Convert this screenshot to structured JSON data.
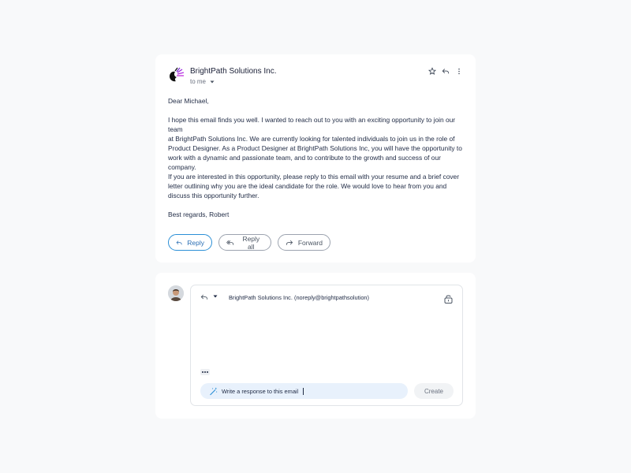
{
  "email": {
    "sender_name": "BrightPath Solutions Inc.",
    "to_label": "to me",
    "icons": [
      "star-icon",
      "reply-icon",
      "more-vertical-icon"
    ],
    "greeting": "Dear Michael,",
    "paragraph_1": [
      "I hope this email finds you well. I wanted to reach out to you with an exciting opportunity to join our team",
      "at BrightPath Solutions Inc. We are currently looking for talented individuals to join us in the role of Product Designer. As a Product Designer at BrightPath Solutions Inc, you will have the opportunity to work with a dynamic and passionate team, and to contribute to the growth and success of our company.",
      "If you are interested in this opportunity, please reply to this email with your resume and a brief cover letter outlining why you are the ideal candidate for the role. We would love to hear from you and discuss this opportunity further."
    ],
    "signoff": "Best regards, Robert",
    "actions": {
      "reply": "Reply",
      "reply_all": "Reply all",
      "forward": "Forward"
    }
  },
  "compose": {
    "recipient": "BrightPath Solutions Inc. (noreply@brightpathsolution)",
    "ai_input_value": "Write a response to this email",
    "create_label": "Create"
  },
  "colors": {
    "accent": "#2b8fd6",
    "ai_input_bg": "#e8f1fc",
    "logo_purple": "#9b27e0"
  }
}
